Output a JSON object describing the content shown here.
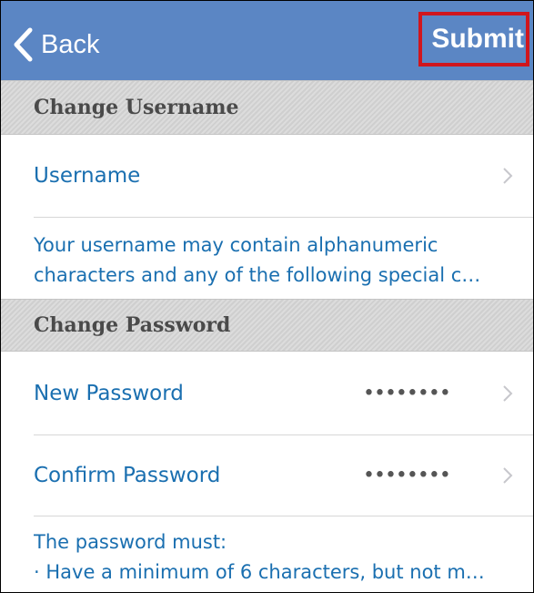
{
  "navbar": {
    "back_label": "Back",
    "submit_label": "Submit",
    "color": "#5b86c4",
    "highlight_color": "#d0161d"
  },
  "username_section": {
    "header": "Change Username",
    "row_label": "Username",
    "note_line1": "Your username may contain alphanumeric",
    "note_line2": "characters and any of the following special c…"
  },
  "password_section": {
    "header": "Change Password",
    "new_label": "New Password",
    "new_value": "••••••••",
    "confirm_label": "Confirm Password",
    "confirm_value": "••••••••",
    "note_line1": "The password must:",
    "note_line2": "· Have a minimum of 6 characters, but not m…"
  },
  "icons": {
    "back": "chevron-left-icon",
    "disclosure": "chevron-right-icon"
  }
}
